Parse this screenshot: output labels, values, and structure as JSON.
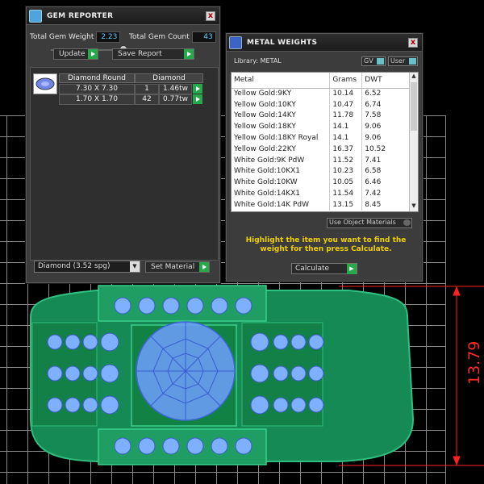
{
  "gem_reporter": {
    "title": "GEM REPORTER",
    "close": "x",
    "total_weight_label": "Total Gem Weight",
    "total_weight_value": "2.23",
    "total_count_label": "Total Gem Count",
    "total_count_value": "43",
    "update_label": "Update",
    "save_report_label": "Save Report",
    "table_headers": [
      "Diamond Round",
      "Diamond"
    ],
    "rows": [
      {
        "size": "7.30 X 7.30",
        "count": "1",
        "weight": "1.46tw"
      },
      {
        "size": "1.70 X 1.70",
        "count": "42",
        "weight": "0.77tw"
      }
    ],
    "material_select": "Diamond    (3.52 spg)",
    "set_material_label": "Set Material"
  },
  "metal_weights": {
    "title": "METAL WEIGHTS",
    "close": "x",
    "library_label": "Library: METAL",
    "gv_label": "GV",
    "user_label": "User",
    "columns": [
      "Metal",
      "Grams",
      "DWT"
    ],
    "rows": [
      {
        "metal": "Yellow Gold:9KY",
        "grams": "10.14",
        "dwt": "6.52"
      },
      {
        "metal": "Yellow Gold:10KY",
        "grams": "10.47",
        "dwt": "6.74"
      },
      {
        "metal": "Yellow Gold:14KY",
        "grams": "11.78",
        "dwt": "7.58"
      },
      {
        "metal": "Yellow Gold:18KY",
        "grams": "14.1",
        "dwt": "9.06"
      },
      {
        "metal": "Yellow Gold:18KY Royal",
        "grams": "14.1",
        "dwt": "9.06"
      },
      {
        "metal": "Yellow Gold:22KY",
        "grams": "16.37",
        "dwt": "10.52"
      },
      {
        "metal": "White Gold:9K PdW",
        "grams": "11.52",
        "dwt": "7.41"
      },
      {
        "metal": "White Gold:10KX1",
        "grams": "10.23",
        "dwt": "6.58"
      },
      {
        "metal": "White Gold:10KW",
        "grams": "10.05",
        "dwt": "6.46"
      },
      {
        "metal": "White Gold:14KX1",
        "grams": "11.54",
        "dwt": "7.42"
      },
      {
        "metal": "White Gold:14K PdW",
        "grams": "13.15",
        "dwt": "8.45"
      }
    ],
    "use_object_materials": "Use Object Materials",
    "hint": "Highlight the item you want to find the weight for then press Calculate.",
    "calculate_label": "Calculate"
  },
  "drawing": {
    "dimension_value": "13.79",
    "colors": {
      "ring_body": "#1a8f5a",
      "ring_light": "#2fbf7a",
      "gem_blue": "#6f9fff",
      "dimension_red": "#ff2020",
      "grid": "#8a8a8a"
    }
  }
}
